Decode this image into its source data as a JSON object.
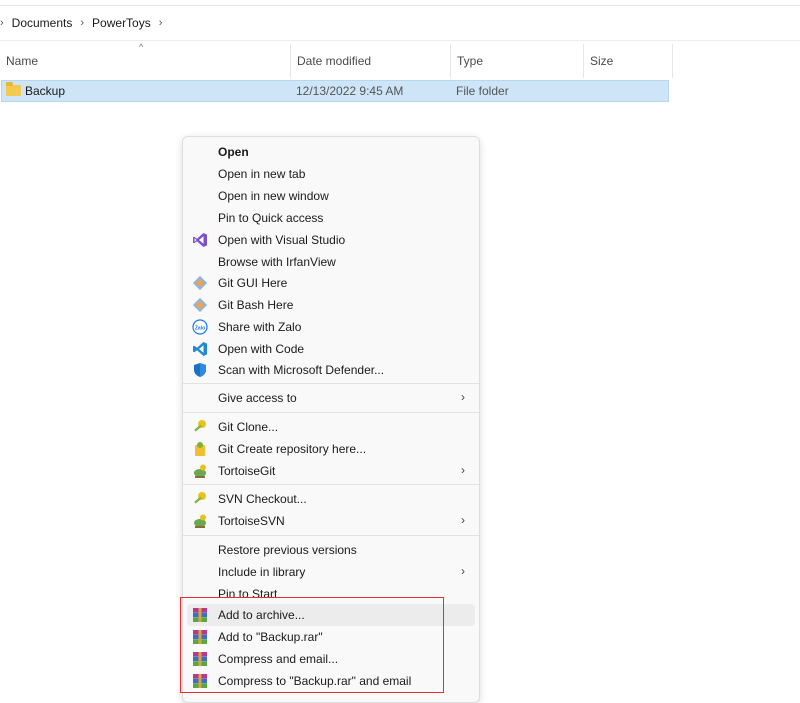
{
  "breadcrumb": {
    "items": [
      "Documents",
      "PowerToys"
    ],
    "separator": "›"
  },
  "columns": {
    "name": "Name",
    "date_modified": "Date modified",
    "type": "Type",
    "size": "Size"
  },
  "row": {
    "name": "Backup",
    "date": "12/13/2022 9:45 AM",
    "type": "File folder",
    "size": ""
  },
  "menu": {
    "open": "Open",
    "open_new_tab": "Open in new tab",
    "open_new_window": "Open in new window",
    "pin_quick_access": "Pin to Quick access",
    "open_visual_studio": "Open with Visual Studio",
    "browse_irfanview": "Browse with IrfanView",
    "git_gui": "Git GUI Here",
    "git_bash": "Git Bash Here",
    "share_zalo": "Share with Zalo",
    "open_code": "Open with Code",
    "scan_defender": "Scan with Microsoft Defender...",
    "give_access": "Give access to",
    "git_clone": "Git Clone...",
    "git_create_repo": "Git Create repository here...",
    "tortoisegit": "TortoiseGit",
    "svn_checkout": "SVN Checkout...",
    "tortoisesvn": "TortoiseSVN",
    "restore_versions": "Restore previous versions",
    "include_library": "Include in library",
    "pin_start": "Pin to Start",
    "add_archive": "Add to archive...",
    "add_rar": "Add to \"Backup.rar\"",
    "compress_email": "Compress and email...",
    "compress_rar_email": "Compress to \"Backup.rar\" and email"
  },
  "colors": {
    "selection": "#cde5f7",
    "highlight_box": "#e03131",
    "menu_bg": "#f9f9f9"
  }
}
